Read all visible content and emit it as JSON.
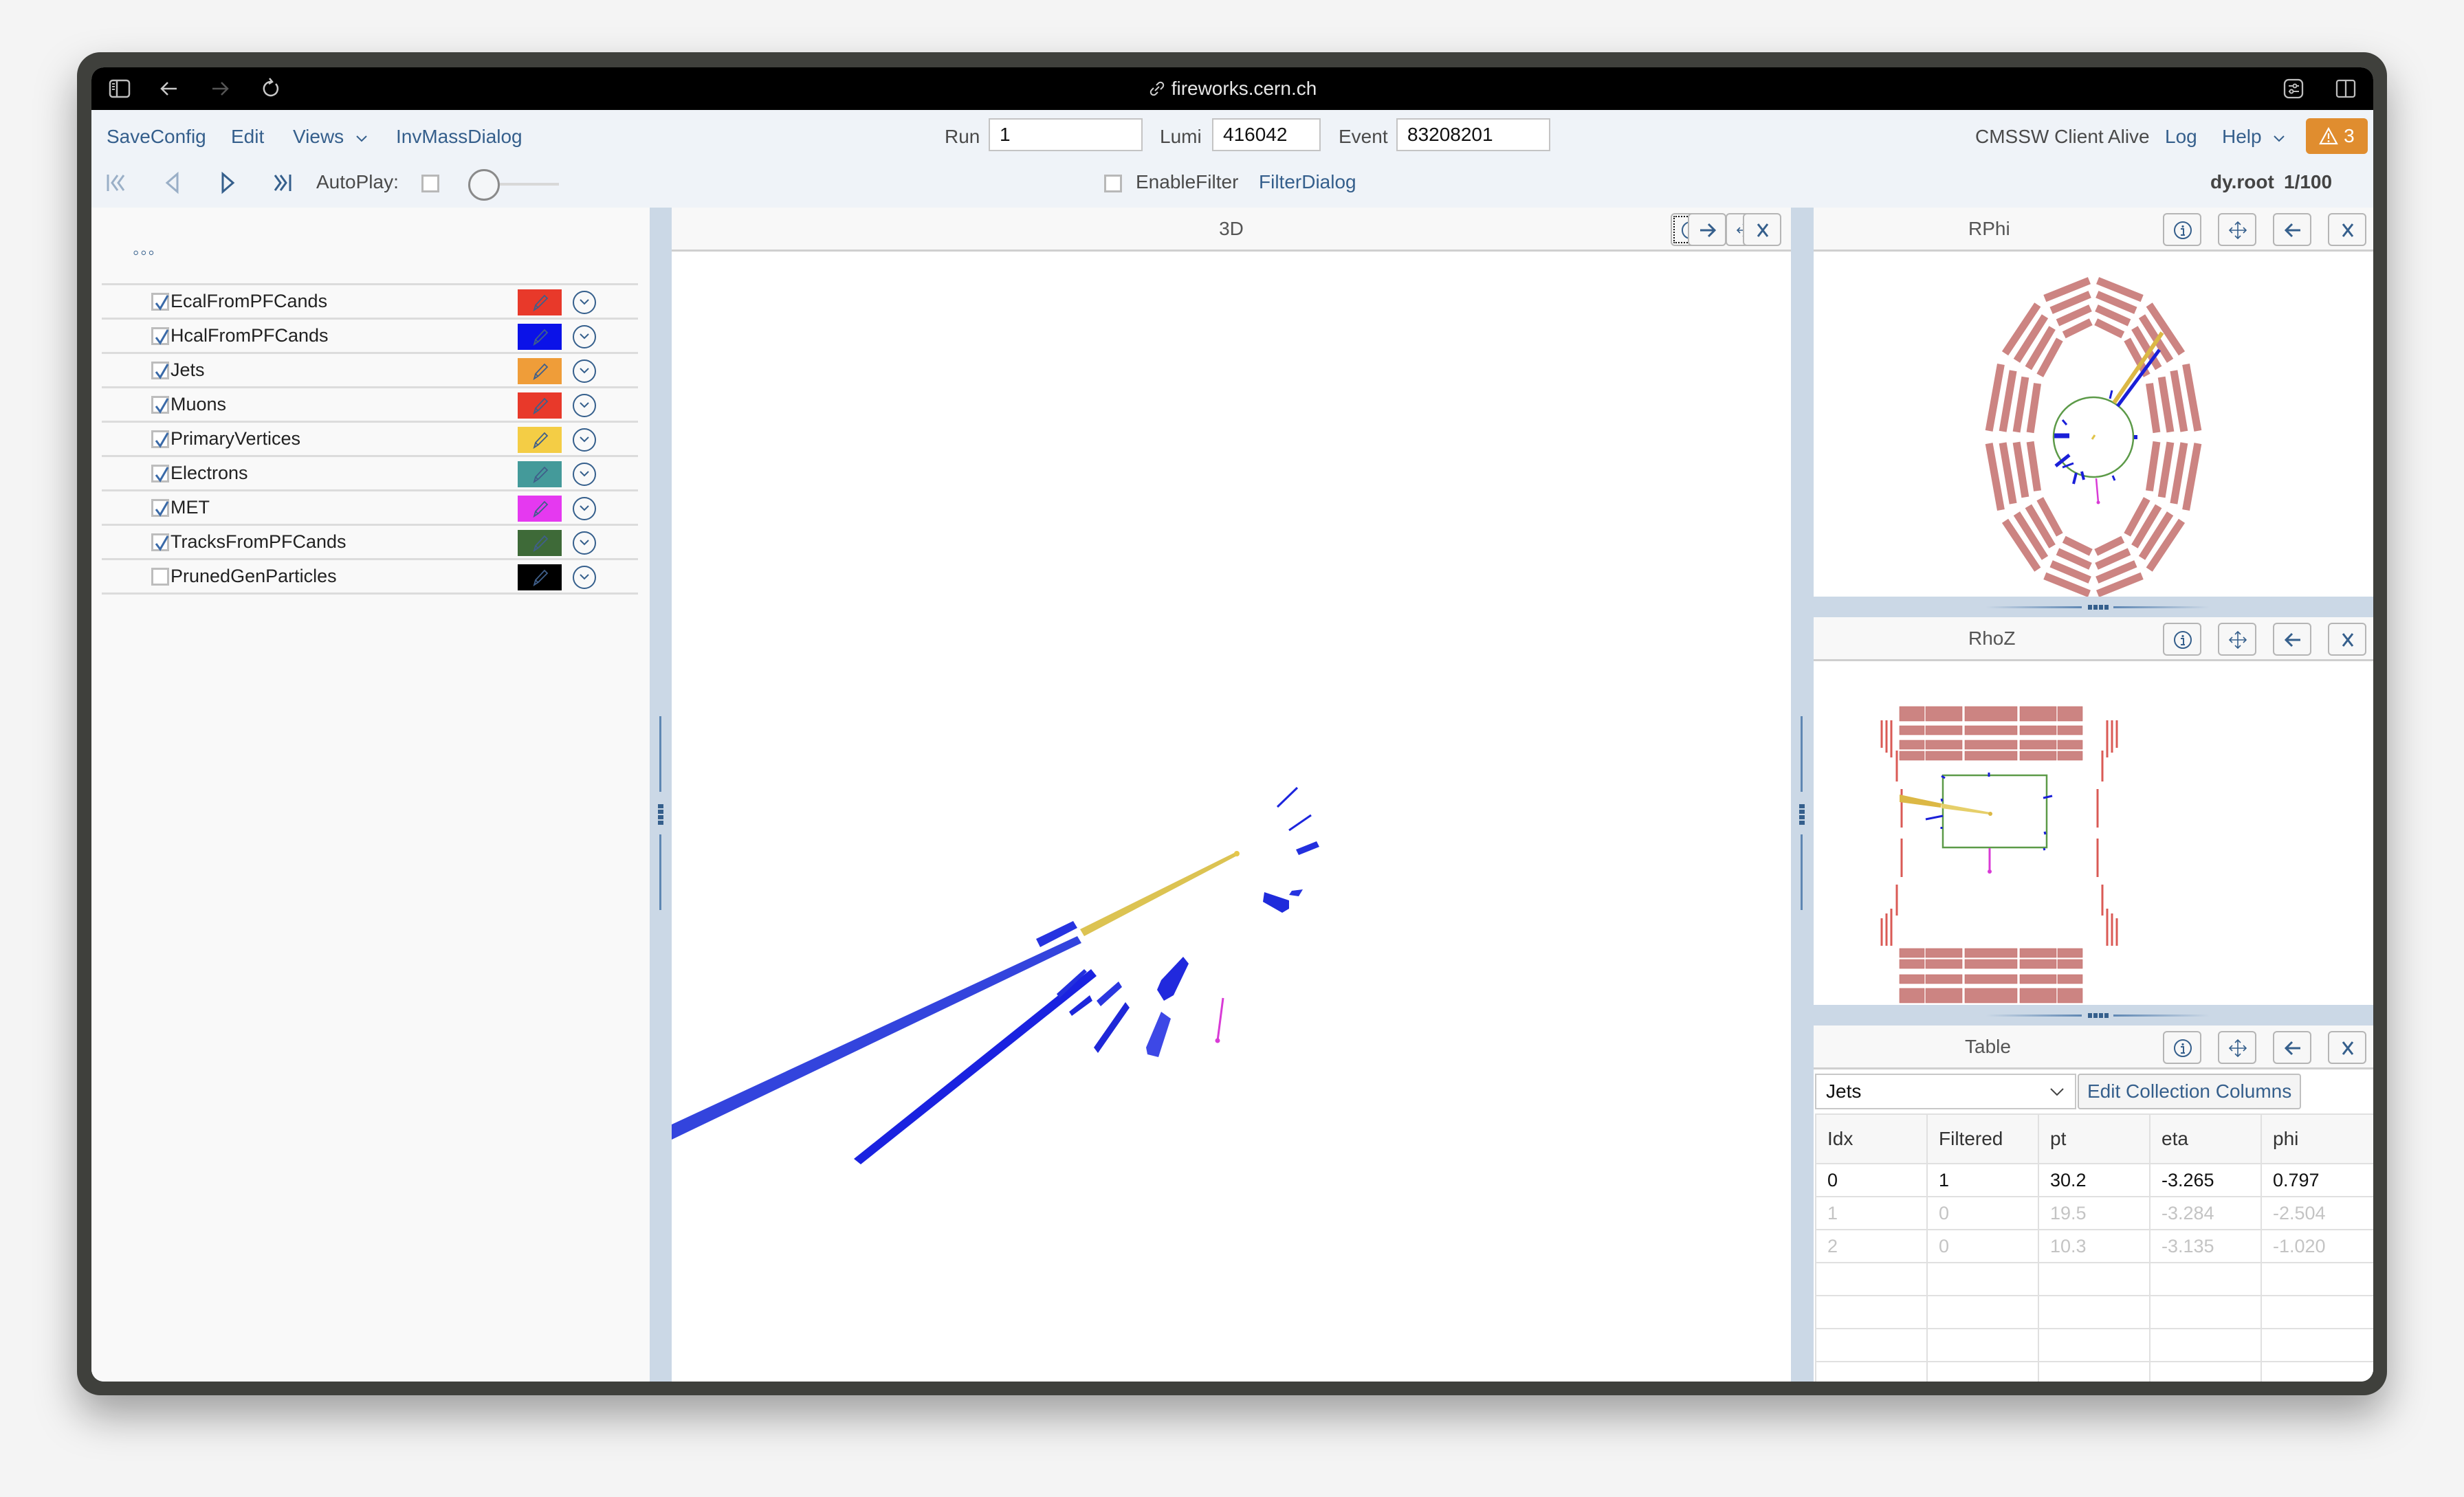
{
  "browser": {
    "url": "fireworks.cern.ch",
    "icons": [
      "sidebar-toggle-icon",
      "back-arrow-icon",
      "forward-arrow-icon",
      "reload-icon",
      "link-icon",
      "page-settings-icon",
      "split-view-icon"
    ]
  },
  "toolbar": {
    "menu": {
      "save_config": "SaveConfig",
      "edit": "Edit",
      "views": "Views",
      "inv_mass": "InvMassDialog"
    },
    "run_label": "Run",
    "run_value": "1",
    "lumi_label": "Lumi",
    "lumi_value": "416042",
    "event_label": "Event",
    "event_value": "83208201",
    "status": "CMSSW Client Alive",
    "log": "Log",
    "help": "Help",
    "warnings_count": "3",
    "autoplay_label": "AutoPlay:",
    "autoplay_checked": false,
    "enable_filter_label": "EnableFilter",
    "enable_filter_checked": false,
    "filter_dialog": "FilterDialog",
    "file_name": "dy.root",
    "event_position": "1/100",
    "warning_color": "#e08d2f"
  },
  "sidebar": {
    "more_label": "◦◦◦",
    "collections": [
      {
        "name": "EcalFromPFCands",
        "checked": true,
        "color": "#e8392a"
      },
      {
        "name": "HcalFromPFCands",
        "checked": true,
        "color": "#0b12e8"
      },
      {
        "name": "Jets",
        "checked": true,
        "color": "#ef9d39"
      },
      {
        "name": "Muons",
        "checked": true,
        "color": "#e8392a"
      },
      {
        "name": "PrimaryVertices",
        "checked": true,
        "color": "#f4cd45"
      },
      {
        "name": "Electrons",
        "checked": true,
        "color": "#449a9a"
      },
      {
        "name": "MET",
        "checked": true,
        "color": "#e539f0"
      },
      {
        "name": "TracksFromPFCands",
        "checked": true,
        "color": "#3e6a38"
      },
      {
        "name": "PrunedGenParticles",
        "checked": false,
        "color": "#000000"
      }
    ]
  },
  "views": {
    "threed": {
      "title": "3D"
    },
    "rphi": {
      "title": "RPhi"
    },
    "rhoz": {
      "title": "RhoZ"
    },
    "table": {
      "title": "Table"
    }
  },
  "table": {
    "collection": "Jets",
    "edit_columns": "Edit Collection Columns",
    "columns": [
      "Idx",
      "Filtered",
      "pt",
      "eta",
      "phi"
    ],
    "rows": [
      {
        "cells": [
          "0",
          "1",
          "30.2",
          "-3.265",
          "0.797"
        ],
        "selected": true
      },
      {
        "cells": [
          "1",
          "0",
          "19.5",
          "-3.284",
          "-2.504"
        ],
        "selected": false
      },
      {
        "cells": [
          "2",
          "0",
          "10.3",
          "-3.135",
          "-1.020"
        ],
        "selected": false
      }
    ],
    "empty_rows": 4
  }
}
